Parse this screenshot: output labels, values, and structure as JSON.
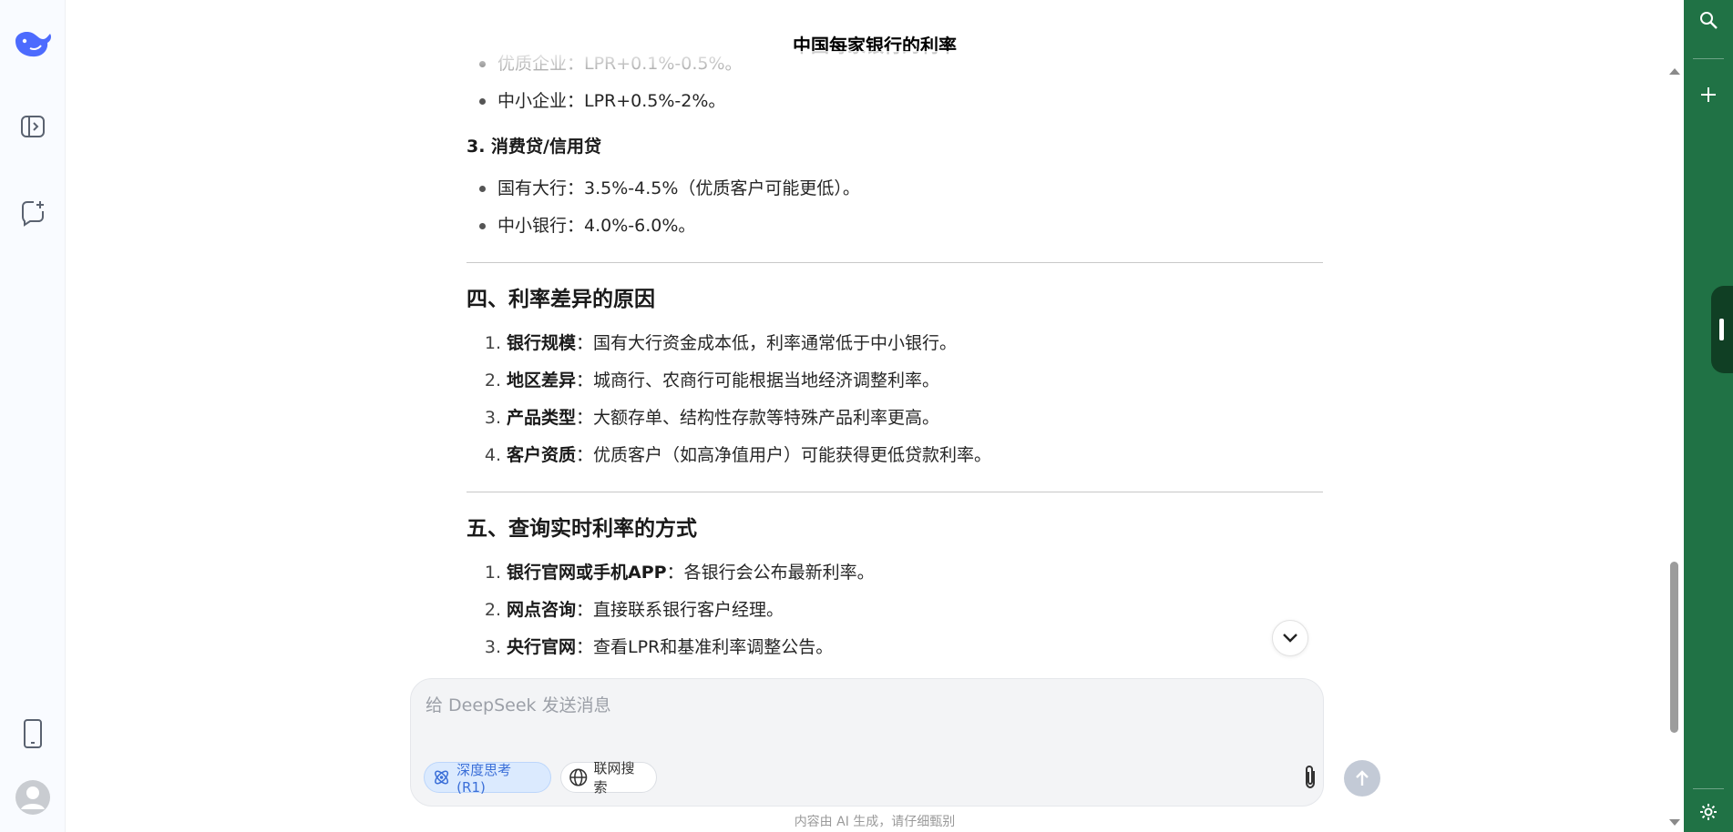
{
  "conversation_title": "中国每家银行的利率",
  "content": {
    "top_bullets": [
      {
        "text": "优质企业：LPR+0.1%-0.5%。"
      },
      {
        "text": "中小企业：LPR+0.5%-2%。"
      }
    ],
    "consumer_loan_heading": "3. 消费贷/信用贷",
    "consumer_loan_bullets": [
      {
        "text": "国有大行：3.5%-4.5%（优质客户可能更低）。"
      },
      {
        "text": "中小银行：4.0%-6.0%。"
      }
    ],
    "section4": {
      "heading": "四、利率差异的原因",
      "items": [
        {
          "num": "1.",
          "bold": "银行规模",
          "text": "：国有大行资金成本低，利率通常低于中小银行。"
        },
        {
          "num": "2.",
          "bold": "地区差异",
          "text": "：城商行、农商行可能根据当地经济调整利率。"
        },
        {
          "num": "3.",
          "bold": "产品类型",
          "text": "：大额存单、结构性存款等特殊产品利率更高。"
        },
        {
          "num": "4.",
          "bold": "客户资质",
          "text": "：优质客户（如高净值用户）可能获得更低贷款利率。"
        }
      ]
    },
    "section5": {
      "heading": "五、查询实时利率的方式",
      "items": [
        {
          "num": "1.",
          "bold": "银行官网或手机APP",
          "text": "：各银行会公布最新利率。"
        },
        {
          "num": "2.",
          "bold": "网点咨询",
          "text": "：直接联系银行客户经理。"
        },
        {
          "num": "3.",
          "bold": "央行官网",
          "text": "：查看LPR和基准利率调整公告。"
        }
      ]
    }
  },
  "composer": {
    "placeholder": "给 DeepSeek 发送消息",
    "deep_think_label": "深度思考 (R1)",
    "web_search_label": "联网搜索"
  },
  "footer_note": "内容由 AI 生成，请仔细甄别",
  "colors": {
    "accent_blue": "#4d6bfe",
    "right_panel_green": "#207245"
  },
  "icons": {
    "sidebar": [
      "deepseek-logo-icon",
      "sidebar-toggle-icon",
      "new-chat-icon",
      "phone-icon",
      "user-avatar-icon"
    ],
    "right_panel": [
      "search-icon",
      "plus-icon",
      "gear-icon"
    ]
  }
}
